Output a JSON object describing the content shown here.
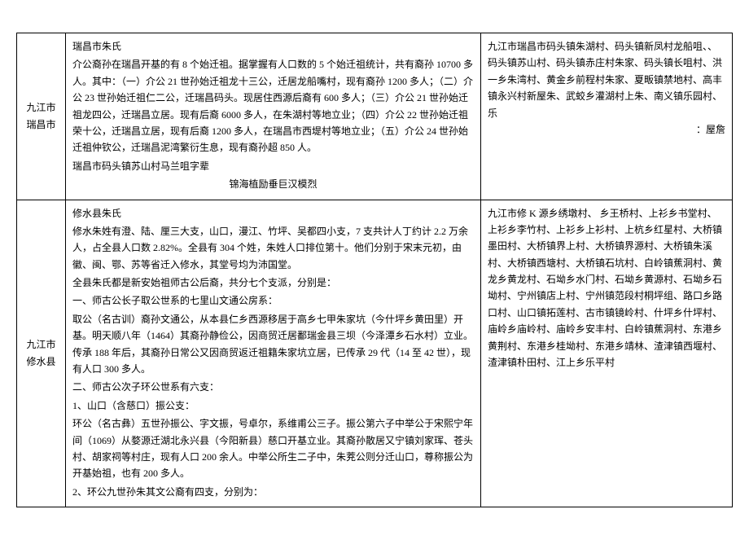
{
  "rows": [
    {
      "region": "九江市瑞昌市",
      "desc": {
        "title": "瑞昌市朱氏",
        "p1": "介公裔孙在瑞昌开基的有 8 个始迁祖。据掌握有人口数的 5 个始迁祖统计，共有裔孙 10700 多人。其中：（一）介公 21 世孙始迁祖龙十三公，迁居龙船嘴村，现有裔孙 1200 多人；（二）介公 23 世孙始迁祖仁二公，迁瑞昌码头。现居住西源后裔有 600 多人；（三）介公 21 世孙始迁祖龙四公，迁瑞昌立居。现有后裔 6000 多人，在朱湖村等地立业；（四）介公 22 世孙始迁祖荣十公，迁瑞昌立居，现有后裔 1200 多人，在瑞昌市西堤村等地立业；（五）介公 24 世孙始迁祖仲钦公，迁瑞昌泥湾繁衍生息，现有裔孙超 850 人。",
        "p2": "瑞昌市码头镇苏山村马兰咀字辈",
        "p3_center": "锦海植励垂巨汉模烈"
      },
      "places": "九江市瑞昌市码头镇朱湖村、码头镇新凤村龙船咀、、码头镇苏山村、码头镇赤庄村朱家、码头镇长咀村、洪一乡朱湾村、黄金乡前程村朱家、夏畈镇禁地村、高丰镇永兴村新屋朱、武蛟乡灌湖村上朱、南义镇乐园村、乐",
      "places_extra": "：屋詹"
    },
    {
      "region": "九江市修水县",
      "desc": {
        "title": "修水县朱氏",
        "p1": "修水朱姓有澄、陆、厘三大支，山口，漫江、竹坪、吴都四小支，7 支共计人丁约计 2.2 万余人，占全县人口数 2.82%。全县有 304 个姓，朱姓人口排位第十。他们分别于宋末元初，由徽、闽、鄂、苏等省迁入修水，其堂号均为沛国堂。",
        "p2": "全县朱氏都是新安始祖师古公后裔，共分七个支派，分别是：",
        "p3": "一、师古公长子取公世系的七里山文通公房系：",
        "p4": "取公（名古训）裔孙文通公，从本县仁乡西源移居于高乡七甲朱家坑（今什坪乡黄田里）开基。明天顺八年（1464）其裔孙静俭公，因商贸迁居鄱瑞金县三坝（今泽潭乡石水村）立业。传承 188 年后，其裔孙日常公又因商贸返迁祖籍朱家坑立居，已传承 29 代（14 至 42 世），现有人口 300 多人。",
        "p5": "二、师古公次子环公世系有六支：",
        "p6": "1、山口（含慈口）振公支：",
        "p7": "环公（名古彝）五世孙振公、字文振，号卓尔，系维甫公三子。振公第六子中举公于宋熙宁年间（1069）从婺源迁湖北永兴县（今阳新县）慈口开基立业。其裔孙散居又宁镇刘家珲、苍头村、胡家祠等村庄，现有人口 200 余人。中举公所生二子中，朱茺公则分迁山口，尊称振公为开基始祖，也有 200 多人。",
        "p8": "2、环公九世孙朱其文公裔有四支，分别为："
      },
      "places": "九江市修                                K 源乡绣墩村、                               乡王桥村、上衫乡书堂村、上衫乡李竹村、上衫乡上衫村、上杭乡红星村、大桥镇墨田村、大桥镇界上村、大桥镇界源村、大桥镇朱溪村、大桥镇西塘村、大桥镇石坑村、白岭镇蕉洞村、黄龙乡黄龙村、石坳乡水门村、石坳乡黄源村、石坳乡石坳村、宁州镇店上村、宁州镇范段村桐坪组、路口乡路口村、山口镇拓莲村、古市镇镜岭村、什坪乡什坪村、庙岭乡庙岭村、庙岭乡安丰村、白岭镇蕉洞村、东港乡黄荆村、东港乡桂坳村、东港乡靖林、渣津镇西堰村、渣津镇朴田村、江上乡乐平村"
    }
  ]
}
